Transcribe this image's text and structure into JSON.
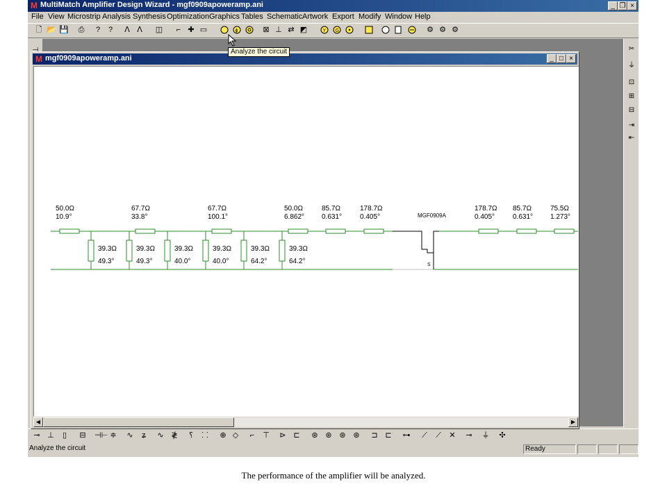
{
  "app": {
    "title": "MultiMatch Amplifier Design Wizard - mgf0909apoweramp.ani",
    "logo": "M"
  },
  "menu": [
    "File",
    "View",
    "Microstrip",
    "Analysis",
    "Synthesis",
    "Optimization",
    "Graphics",
    "Tables",
    "Schematic",
    "Artwork",
    "Export",
    "Modify",
    "Window",
    "Help"
  ],
  "tooltip": "Analyze the circuit",
  "document": {
    "title": "mgf0909apoweramp.ani"
  },
  "schematic": {
    "series": [
      {
        "z": "50.0Ω",
        "e": "10.9°"
      },
      {
        "z": "67.7Ω",
        "e": "33.8°"
      },
      {
        "z": "67.7Ω",
        "e": "100.1°"
      },
      {
        "z": "50.0Ω",
        "e": "6.862°"
      },
      {
        "z": "85.7Ω",
        "e": "0.631°"
      },
      {
        "z": "178.7Ω",
        "e": "0.405°"
      },
      {
        "z": "178.7Ω",
        "e": "0.405°"
      },
      {
        "z": "85.7Ω",
        "e": "0.631°"
      },
      {
        "z": "75.5Ω",
        "e": "1.273°"
      }
    ],
    "stubs": [
      {
        "z": "39.3Ω",
        "e": "49.3°"
      },
      {
        "z": "39.3Ω",
        "e": "49.3°"
      },
      {
        "z": "39.3Ω",
        "e": "40.0°"
      },
      {
        "z": "39.3Ω",
        "e": "40.0°"
      },
      {
        "z": "39.3Ω",
        "e": "64.2°"
      },
      {
        "z": "39.3Ω",
        "e": "64.2°"
      }
    ],
    "device": {
      "label": "MGF0909A",
      "pin": "S"
    },
    "line_color": "#2e8b2e"
  },
  "status": {
    "message": "Analyze the circuit",
    "state": "Ready"
  },
  "caption": "The performance of the amplifier will be analyzed."
}
